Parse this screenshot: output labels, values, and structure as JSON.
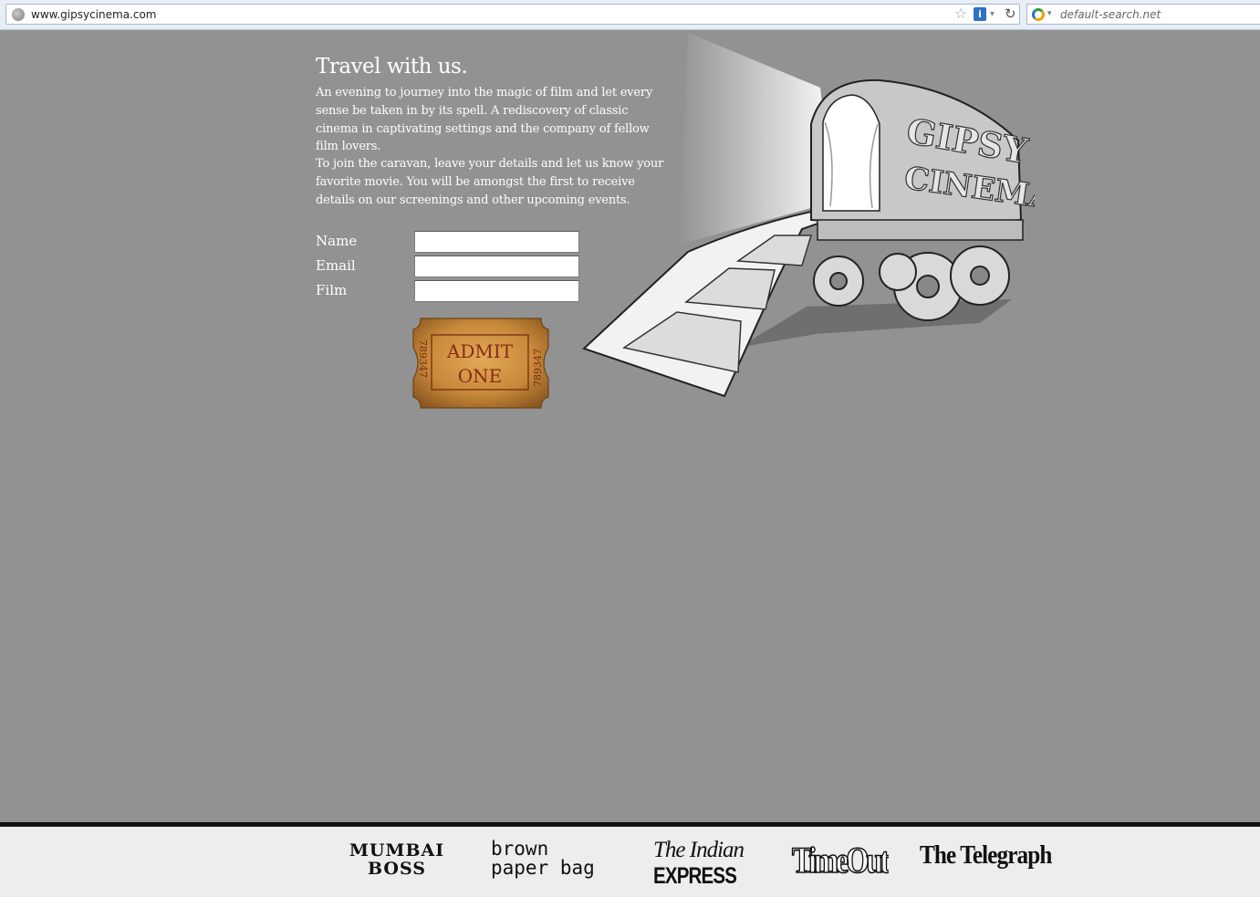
{
  "browser": {
    "url": "www.gipsycinema.com",
    "search_placeholder": "default-search.net",
    "info_glyph": "i",
    "star_glyph": "☆",
    "reload_glyph": "↻",
    "dropdown_glyph": "▾"
  },
  "main": {
    "heading": "Travel with us.",
    "paragraph1": "An evening to journey into the magic of film and let every sense be taken in by its spell. A rediscovery of classic cinema in captivating settings and the company of fellow film lovers.",
    "paragraph2": "To join the caravan, leave your details and let us know your favorite movie. You will be amongst the first to receive details on our screenings and other upcoming events."
  },
  "form": {
    "name_label": "Name",
    "email_label": "Email",
    "film_label": "Film",
    "name_value": "",
    "email_value": "",
    "film_value": ""
  },
  "ticket": {
    "line1": "ADMIT",
    "line2": "ONE",
    "serial_left": "789347",
    "serial_right": "789347"
  },
  "illustration": {
    "sign_line1": "GIPSY",
    "sign_line2": "CINEMA"
  },
  "footer": {
    "mumbai_line1": "MUMBAI",
    "mumbai_line2": "BOSS",
    "brown_line1": "brown",
    "brown_line2": "paper bag",
    "indian_line1": "The Indian",
    "indian_line2": "EXPRESS",
    "timeout": "TimeOut",
    "telegraph": "The Telegraph"
  },
  "colors": {
    "page_background": "#929292",
    "footer_background": "#ededed",
    "ticket_gold": "#c98a3a",
    "ticket_text": "#8a2a14"
  }
}
